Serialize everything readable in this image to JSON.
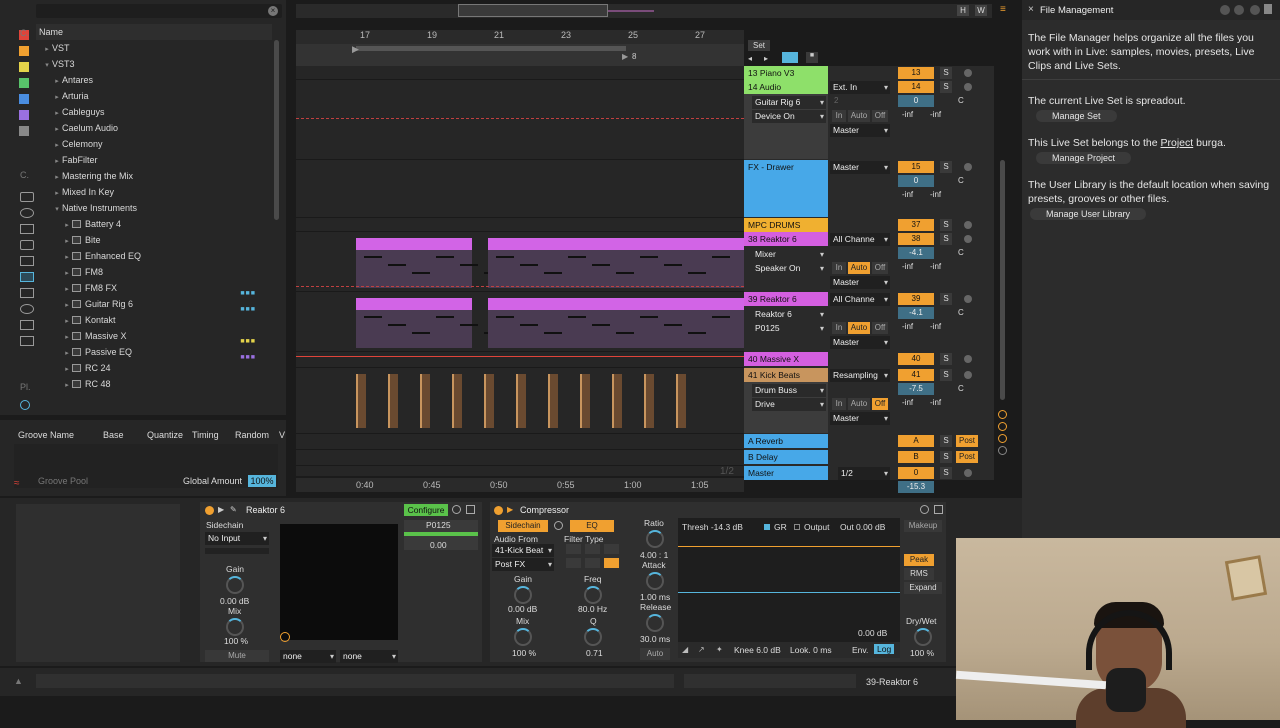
{
  "browser": {
    "header": "Name",
    "items": [
      {
        "label": "VST",
        "level": 0,
        "tri": "▸",
        "folder": true
      },
      {
        "label": "VST3",
        "level": 0,
        "tri": "▾",
        "folder": true
      },
      {
        "label": "Antares",
        "level": 1,
        "tri": "▸",
        "folder": true
      },
      {
        "label": "Arturia",
        "level": 1,
        "tri": "▸",
        "folder": true
      },
      {
        "label": "Cableguys",
        "level": 1,
        "tri": "▸",
        "folder": true
      },
      {
        "label": "Caelum Audio",
        "level": 1,
        "tri": "▸",
        "folder": true
      },
      {
        "label": "Celemony",
        "level": 1,
        "tri": "▸",
        "folder": true
      },
      {
        "label": "FabFilter",
        "level": 1,
        "tri": "▸",
        "folder": true
      },
      {
        "label": "Mastering the Mix",
        "level": 1,
        "tri": "▸",
        "folder": true
      },
      {
        "label": "Mixed In Key",
        "level": 1,
        "tri": "▸",
        "folder": true
      },
      {
        "label": "Native Instruments",
        "level": 1,
        "tri": "▾",
        "folder": true
      },
      {
        "label": "Battery 4",
        "level": 2,
        "tri": "▸",
        "folder": false
      },
      {
        "label": "Bite",
        "level": 2,
        "tri": "▸",
        "folder": false
      },
      {
        "label": "Enhanced EQ",
        "level": 2,
        "tri": "▸",
        "folder": false
      },
      {
        "label": "FM8",
        "level": 2,
        "tri": "▸",
        "folder": false
      },
      {
        "label": "FM8 FX",
        "level": 2,
        "tri": "▸",
        "folder": false
      },
      {
        "label": "Guitar Rig 6",
        "level": 2,
        "tri": "▸",
        "folder": false
      },
      {
        "label": "Kontakt",
        "level": 2,
        "tri": "▸",
        "folder": false
      },
      {
        "label": "Massive X",
        "level": 2,
        "tri": "▸",
        "folder": false
      },
      {
        "label": "Passive EQ",
        "level": 2,
        "tri": "▸",
        "folder": false
      },
      {
        "label": "RC 24",
        "level": 2,
        "tri": "▸",
        "folder": false
      },
      {
        "label": "RC 48",
        "level": 2,
        "tri": "▸",
        "folder": false
      }
    ],
    "sidebar_labels": [
      "C.",
      "C.",
      "Pl."
    ]
  },
  "groove": {
    "columns": [
      "Groove Name",
      "Base",
      "Quantize",
      "Timing",
      "Random",
      "V"
    ],
    "pool_label": "Groove Pool",
    "global_amount_label": "Global Amount",
    "global_amount_value": "100%"
  },
  "arrangement": {
    "bar_ticks": [
      "17",
      "19",
      "21",
      "23",
      "25",
      "27"
    ],
    "time_ticks": [
      "0:40",
      "0:45",
      "0:50",
      "0:55",
      "1:00",
      "1:05"
    ],
    "set_label": "Set",
    "loop_marker": "8",
    "page_indicator": "1/2"
  },
  "tracks": [
    {
      "name": "13 Piano V3",
      "color": "#8ee06a",
      "num": "13",
      "vol": ""
    },
    {
      "name": "14 Audio",
      "color": "#8ee06a",
      "num": "14",
      "vol": "0",
      "in": "Ext. In",
      "sub": "Guitar Rig 6",
      "sub2": "Device On",
      "out": "Master",
      "ch": "2"
    },
    {
      "name": "FX - Drawer",
      "color": "#47a8e8",
      "num": "15",
      "vol": "0",
      "out": "Master"
    },
    {
      "name": "MPC DRUMS",
      "color": "#f0b030",
      "num": "37"
    },
    {
      "name": "38 Reaktor 6",
      "color": "#d45fe0",
      "num": "38",
      "vol": "-4.1",
      "in": "All Channe",
      "sub": "Mixer",
      "sub2": "Speaker On",
      "out": "Master"
    },
    {
      "name": "39 Reaktor 6",
      "color": "#d45fe0",
      "num": "39",
      "vol": "-4.1",
      "in": "All Channe",
      "sub": "Reaktor 6",
      "sub2": "P0125",
      "out": "Master"
    },
    {
      "name": "40 Massive X",
      "color": "#d45fe0",
      "num": "40"
    },
    {
      "name": "41 Kick Beats",
      "color": "#c8955e",
      "num": "41",
      "vol": "-7.5",
      "in": "Resampling",
      "sub": "Drum Buss",
      "sub2": "Drive",
      "out": "Master"
    },
    {
      "name": "A Reverb",
      "color": "#47a8e8",
      "num": "A",
      "send": "Post"
    },
    {
      "name": "B Delay",
      "color": "#47a8e8",
      "num": "B",
      "send": "Post"
    },
    {
      "name": "Master",
      "color": "#47a8e8",
      "num": "0",
      "vol": "-15.3",
      "master_sel": "1/2"
    }
  ],
  "mixer_labels": {
    "s": "S",
    "c": "C",
    "inf": "-inf",
    "in": "In",
    "auto": "Auto",
    "off": "Off"
  },
  "devices": {
    "reaktor": {
      "title": "Reaktor 6",
      "configure": "Configure",
      "sidechain": "Sidechain",
      "sidechain_input": "No Input",
      "gain_label": "Gain",
      "gain_value": "0.00 dB",
      "mix_label": "Mix",
      "mix_value": "100 %",
      "mute": "Mute",
      "preset": "P0125",
      "preset_value": "0.00",
      "none1": "none",
      "none2": "none"
    },
    "compressor": {
      "title": "Compressor",
      "sidechain": "Sidechain",
      "eq": "EQ",
      "audio_from": "Audio From",
      "source": "41-Kick Beat",
      "post": "Post FX",
      "filter_type": "Filter Type",
      "gain_label": "Gain",
      "gain_value": "0.00 dB",
      "mix_label": "Mix",
      "mix_value": "100 %",
      "freq_label": "Freq",
      "freq_value": "80.0 Hz",
      "q_label": "Q",
      "q_value": "0.71",
      "ratio_label": "Ratio",
      "ratio_value": "4.00 : 1",
      "attack_label": "Attack",
      "attack_value": "1.00 ms",
      "release_label": "Release",
      "release_value": "30.0 ms",
      "auto": "Auto",
      "thresh": "Thresh -14.3 dB",
      "gr": "GR",
      "output": "Output",
      "out_value": "Out 0.00 dB",
      "graph_value": "0.00 dB",
      "makeup": "Makeup",
      "peak": "Peak",
      "rms": "RMS",
      "expand": "Expand",
      "drywet_label": "Dry/Wet",
      "drywet_value": "100 %",
      "knee": "Knee 6.0 dB",
      "look": "Look. 0 ms",
      "env": "Env.",
      "log": "Log"
    }
  },
  "status": {
    "track": "39-Reaktor 6"
  },
  "file_management": {
    "title": "File Management",
    "p1": "The File Manager helps organize all the files you work with in Live: samples, movies, presets, Live Clips and Live Sets.",
    "p2": "The current Live Set is spreadout.",
    "b2": "Manage Set",
    "p3a": "This Live Set belongs to the ",
    "p3link": "Project",
    "p3b": " burga.",
    "b3": "Manage Project",
    "p4": "The User Library is the default location when saving presets, grooves or other files.",
    "b4": "Manage User Library"
  },
  "top_buttons": {
    "h": "H",
    "w": "W"
  }
}
